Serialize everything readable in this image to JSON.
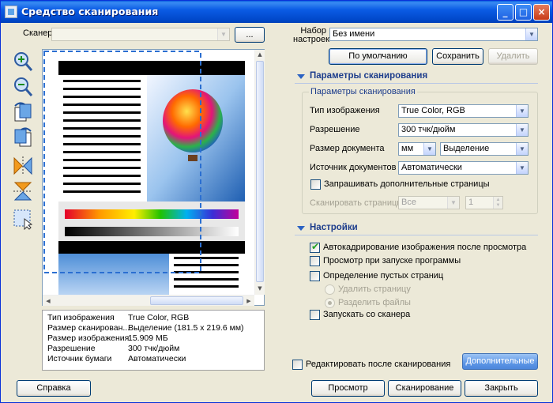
{
  "window": {
    "title": "Средство сканирования"
  },
  "scanner": {
    "label": "Сканер",
    "value": "",
    "browse_label": "..."
  },
  "preset": {
    "label": "Набор настроек",
    "value": "Без имени",
    "default_label": "По умолчанию",
    "save_label": "Сохранить",
    "delete_label": "Удалить"
  },
  "scan_params": {
    "section_title": "Параметры сканирования",
    "group_title": "Параметры сканирования",
    "image_type_label": "Тип изображения",
    "image_type_value": "True Color, RGB",
    "resolution_label": "Разрешение",
    "resolution_value": "300 тчк/дюйм",
    "doc_size_label": "Размер документа",
    "doc_size_unit": "мм",
    "doc_size_value": "Выделение",
    "doc_source_label": "Источник документов",
    "doc_source_value": "Автоматически",
    "ask_more_pages_label": "Запрашивать дополнительные страницы",
    "scan_pages_label": "Сканировать страницы",
    "scan_pages_value": "Все",
    "scan_pages_count": "1"
  },
  "settings": {
    "section_title": "Настройки",
    "autocrop_label": "Автокадрирование изображения после просмотра",
    "preview_on_start_label": "Просмотр при запуске программы",
    "detect_blank_label": "Определение пустых страниц",
    "delete_page_label": "Удалить страницу",
    "split_files_label": "Разделить файлы",
    "start_from_scanner_label": "Запускать со сканера"
  },
  "edit_after_scan_label": "Редактировать после сканирования",
  "advanced_label": "Дополнительные",
  "info": {
    "rows": [
      {
        "label": "Тип изображения",
        "value": "True Color, RGB"
      },
      {
        "label": "Размер сканирован...",
        "value": "Выделение (181.5 x 219.6 мм)"
      },
      {
        "label": "Размер изображения",
        "value": "15.909 МБ"
      },
      {
        "label": "Разрешение",
        "value": "300 тчк/дюйм"
      },
      {
        "label": "Источник бумаги",
        "value": "Автоматически"
      }
    ]
  },
  "footer": {
    "help_label": "Справка",
    "preview_label": "Просмотр",
    "scan_label": "Сканирование",
    "close_label": "Закрыть"
  },
  "colors": {
    "titlebar": "#0b5ce5",
    "section_title": "#1d3d8c",
    "selection_dash": "#2b6fd1"
  }
}
